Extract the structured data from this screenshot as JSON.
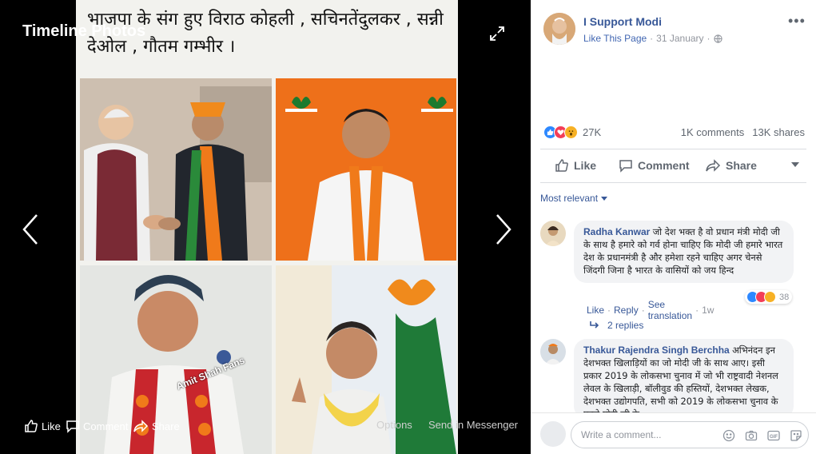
{
  "viewer": {
    "title": "Timeline Photos",
    "caption": "भाजपा के संग हुए विराठ कोहली , सचिनतेंदुलकर , सन्नी देओल , गौतम गम्भीर ।",
    "watermark": "Amit Shah Fans",
    "actions": {
      "like": "Like",
      "comment": "Comment",
      "share": "Share",
      "options": "Options",
      "send": "Send in Messenger"
    }
  },
  "post": {
    "page_name": "I Support Modi",
    "like_page": "Like This Page",
    "date": "31 January",
    "reaction_count": "27K",
    "comments_count": "1K comments",
    "shares_count": "13K shares",
    "actions": {
      "like": "Like",
      "comment": "Comment",
      "share": "Share"
    },
    "sort_label": "Most relevant"
  },
  "comments": [
    {
      "author": "Radha Kanwar",
      "text": "जो देश भक्त है वो प्रधान मंत्री मोदी जी के साथ है हमारे को गर्व होना चाहिए कि मोदी जी हमारे भारत देश के प्रधानमंत्री है और हमेशा रहने चाहिए अगर चेनसे जिंदगी जिना है भारत के वासियों को जय हिन्द",
      "like": "Like",
      "reply": "Reply",
      "see_translation": "See translation",
      "time": "1w",
      "reaction_count": "38",
      "replies": "2 replies"
    },
    {
      "author": "Thakur Rajendra Singh Berchha",
      "text": "अभिनंदन इन देशभक्त खिलाड़ियों का जो मोदी जी के साथ आए। इसी प्रकार 2019 के लोकसभा चुनाव में जो भी राष्ट्रवादी नेशनल लेवल के खिलाड़ी, बॉलीवुड की हस्तियों, देशभक्त लेखक, देशभक्त उद्योगपति, सभी को 2019 के लोकसभा चुनाव के पहले मोदी जी के"
    }
  ],
  "composer": {
    "placeholder": "Write a comment..."
  },
  "colors": {
    "link": "#385898",
    "like_blue": "#2d88ff",
    "love_red": "#f33e58",
    "wow_yellow": "#f7b125",
    "saffron": "#f07a1a"
  }
}
